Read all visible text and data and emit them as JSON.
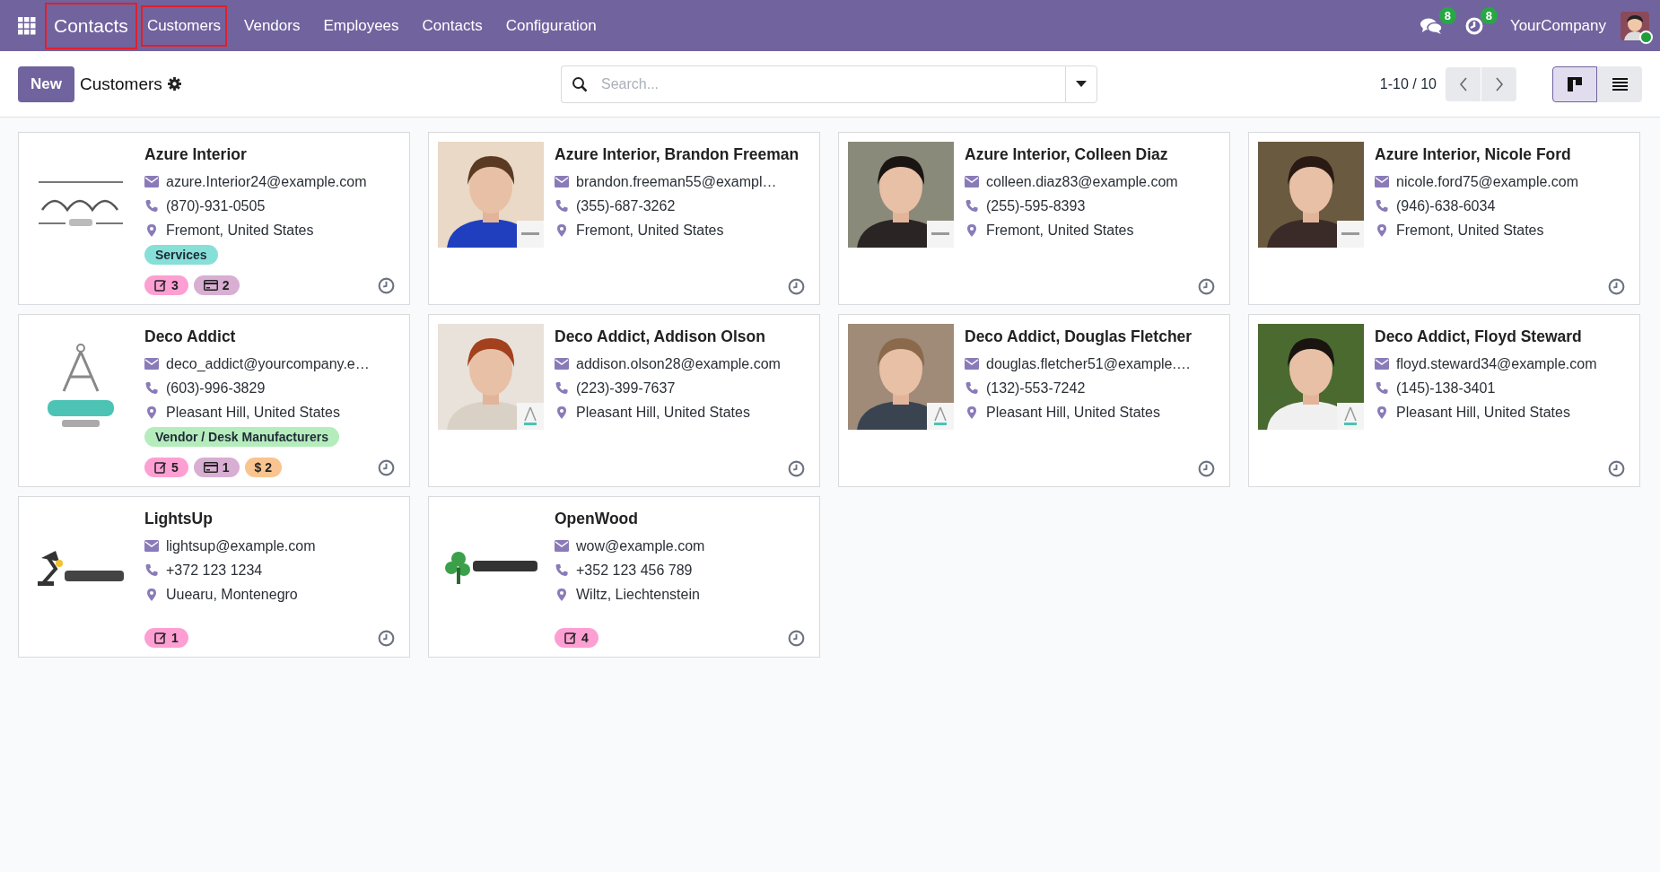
{
  "navbar": {
    "app_name": "Contacts",
    "app_name_annotated": true,
    "menu": [
      {
        "label": "Customers",
        "annotated": true
      },
      {
        "label": "Vendors",
        "annotated": false
      },
      {
        "label": "Employees",
        "annotated": false
      },
      {
        "label": "Contacts",
        "annotated": false
      },
      {
        "label": "Configuration",
        "annotated": false
      }
    ],
    "messages_count": "8",
    "activities_count": "8",
    "company": "YourCompany",
    "user_avatar": {
      "kind": "picture"
    },
    "user_online": true
  },
  "control_panel": {
    "new_button": "New",
    "title": "Customers",
    "search": {
      "placeholder": "Search..."
    },
    "pager": "1-10 / 10",
    "views": [
      {
        "kind": "kanban",
        "selected": true
      },
      {
        "kind": "list",
        "selected": false
      }
    ]
  },
  "cards": [
    {
      "name": "Azure Interior",
      "image": {
        "kind": "picture"
      },
      "email": "azure.Interior24@example.com",
      "phone": "(870)-931-0505",
      "address": "Fremont, United States",
      "tags": [
        {
          "label": "Services",
          "color": "#87e0d7"
        }
      ],
      "counters": [
        {
          "kind": "notes",
          "label": "3"
        },
        {
          "kind": "payment",
          "label": "2"
        }
      ]
    },
    {
      "name": "Azure Interior, Brandon Freeman",
      "image": {
        "kind": "picture"
      },
      "email": "brandon.freeman55@exampl…",
      "phone": "(355)-687-3262",
      "address": "Fremont, United States"
    },
    {
      "name": "Azure Interior, Colleen Diaz",
      "image": {
        "kind": "picture"
      },
      "email": "colleen.diaz83@example.com",
      "phone": "(255)-595-8393",
      "address": "Fremont, United States"
    },
    {
      "name": "Azure Interior, Nicole Ford",
      "image": {
        "kind": "picture"
      },
      "email": "nicole.ford75@example.com",
      "phone": "(946)-638-6034",
      "address": "Fremont, United States"
    },
    {
      "name": "Deco Addict",
      "image": {
        "kind": "picture"
      },
      "email": "deco_addict@yourcompany.e…",
      "phone": "(603)-996-3829",
      "address": "Pleasant Hill, United States",
      "tags": [
        {
          "label": "Vendor / Desk Manufacturers",
          "color": "#b5ecbc"
        }
      ],
      "counters": [
        {
          "kind": "notes",
          "label": "5"
        },
        {
          "kind": "payment",
          "label": "1"
        },
        {
          "kind": "sales",
          "label": "$ 2"
        }
      ]
    },
    {
      "name": "Deco Addict, Addison Olson",
      "image": {
        "kind": "picture"
      },
      "email": "addison.olson28@example.com",
      "phone": "(223)-399-7637",
      "address": "Pleasant Hill, United States"
    },
    {
      "name": "Deco Addict, Douglas Fletcher",
      "image": {
        "kind": "picture"
      },
      "email": "douglas.fletcher51@example.…",
      "phone": "(132)-553-7242",
      "address": "Pleasant Hill, United States"
    },
    {
      "name": "Deco Addict, Floyd Steward",
      "image": {
        "kind": "picture"
      },
      "email": "floyd.steward34@example.com",
      "phone": "(145)-138-3401",
      "address": "Pleasant Hill, United States"
    },
    {
      "name": "LightsUp",
      "image": {
        "kind": "picture"
      },
      "email": "lightsup@example.com",
      "phone": "+372 123 1234",
      "address": "Uuearu, Montenegro",
      "counters": [
        {
          "kind": "notes",
          "label": "1"
        }
      ]
    },
    {
      "name": "OpenWood",
      "image": {
        "kind": "picture"
      },
      "email": "wow@example.com",
      "phone": "+352 123 456 789",
      "address": "Wiltz, Liechtenstein",
      "counters": [
        {
          "kind": "notes",
          "label": "4"
        }
      ]
    }
  ]
}
